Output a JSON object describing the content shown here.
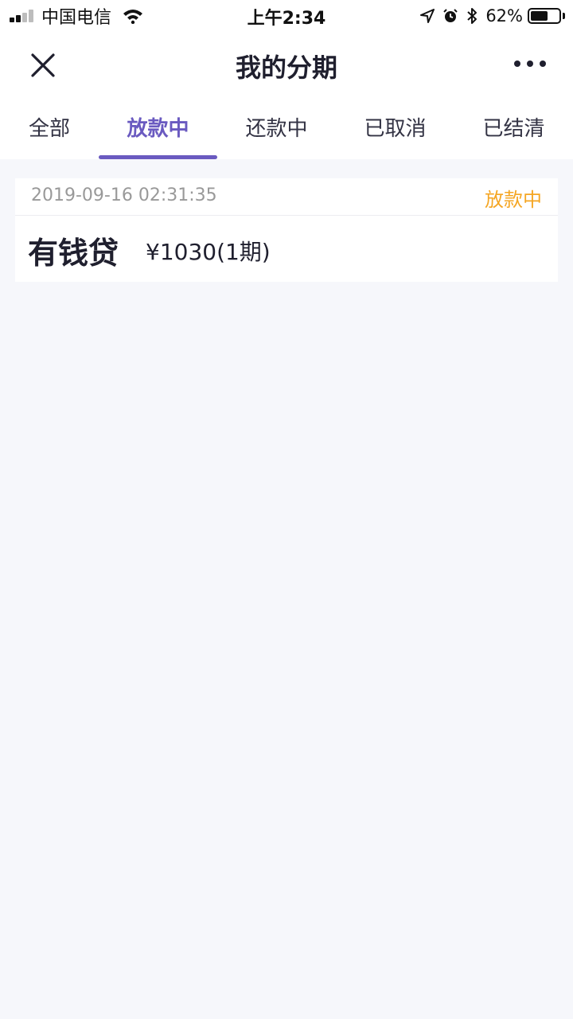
{
  "status_bar": {
    "carrier": "中国电信",
    "time": "上午2:34",
    "battery": "62%",
    "battery_level": 0.62,
    "icons": [
      "signal-icon",
      "wifi-icon",
      "location-icon",
      "alarm-icon",
      "bluetooth-icon",
      "battery-icon"
    ]
  },
  "nav": {
    "title": "我的分期",
    "left_icon": "close-icon",
    "right_icon": "more-icon"
  },
  "tabs": [
    {
      "label": "全部",
      "active": false
    },
    {
      "label": "放款中",
      "active": true
    },
    {
      "label": "还款中",
      "active": false
    },
    {
      "label": "已取消",
      "active": false
    },
    {
      "label": "已结清",
      "active": false
    }
  ],
  "colors": {
    "accent": "#6a5ac0",
    "status_pending": "#f5a623",
    "background": "#f6f7fb"
  },
  "records": [
    {
      "date": "2019-09-16 02:31:35",
      "status": "放款中",
      "product": "有钱贷",
      "amount": "¥1030(1期)"
    }
  ]
}
